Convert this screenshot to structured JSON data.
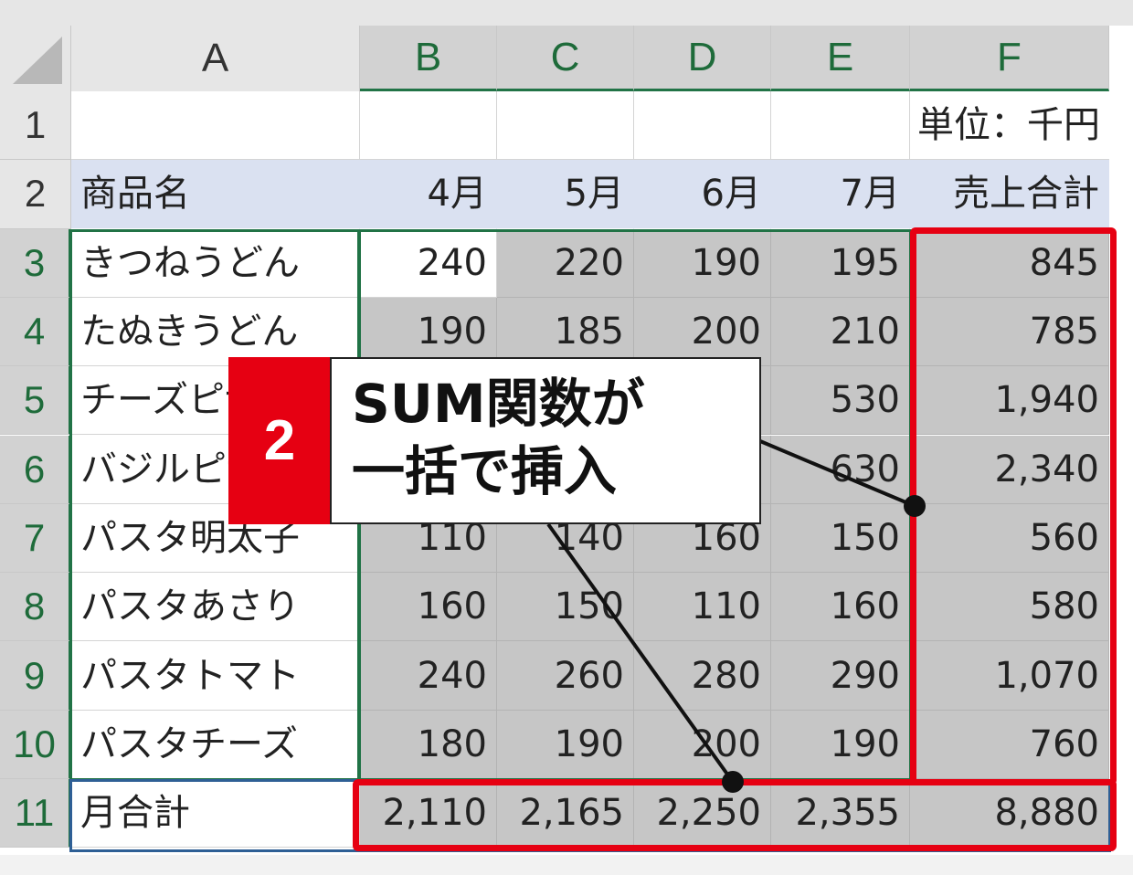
{
  "columns": [
    "A",
    "B",
    "C",
    "D",
    "E",
    "F"
  ],
  "rows": [
    "1",
    "2",
    "3",
    "4",
    "5",
    "6",
    "7",
    "8",
    "9",
    "10",
    "11"
  ],
  "unit_label": "単位：千円",
  "header": {
    "product": "商品名",
    "months": [
      "4月",
      "5月",
      "6月",
      "7月"
    ],
    "total": "売上合計"
  },
  "products": [
    {
      "name": "きつねうどん",
      "values": [
        "240",
        "220",
        "190",
        "195"
      ],
      "total": "845"
    },
    {
      "name": "たぬきうどん",
      "values": [
        "190",
        "185",
        "200",
        "210"
      ],
      "total": "785"
    },
    {
      "name": "チーズピザ",
      "values": [
        "",
        "",
        "",
        "530"
      ],
      "total": "1,940"
    },
    {
      "name": "バジルピザ",
      "values": [
        "",
        "",
        "",
        "630"
      ],
      "total": "2,340"
    },
    {
      "name": "パスタ明太子",
      "values": [
        "110",
        "140",
        "160",
        "150"
      ],
      "total": "560"
    },
    {
      "name": "パスタあさり",
      "values": [
        "160",
        "150",
        "110",
        "160"
      ],
      "total": "580"
    },
    {
      "name": "パスタトマト",
      "values": [
        "240",
        "260",
        "280",
        "290"
      ],
      "total": "1,070"
    },
    {
      "name": "パスタチーズ",
      "values": [
        "180",
        "190",
        "200",
        "190"
      ],
      "total": "760"
    }
  ],
  "monthly_total": {
    "label": "月合計",
    "values": [
      "2,110",
      "2,165",
      "2,250",
      "2,355"
    ],
    "total": "8,880"
  },
  "callout": {
    "step": "2",
    "line1": "SUM関数が",
    "line2": "一括で挿入"
  },
  "colors": {
    "selection": "#c6c6c6",
    "header_fill": "#dae1f1",
    "excel_green": "#217346",
    "highlight_red": "#e60012"
  }
}
